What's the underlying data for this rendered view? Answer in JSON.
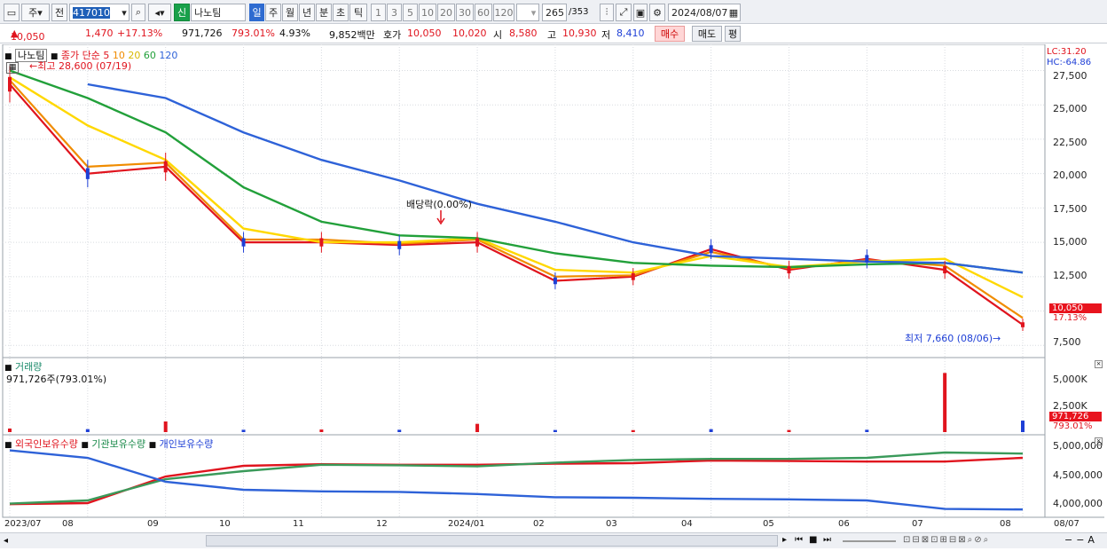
{
  "toolbar": {
    "mode": "주",
    "prev": "전",
    "code": "417010",
    "market": "신",
    "name": "나노팀",
    "periods": [
      "일",
      "주",
      "월",
      "년",
      "분",
      "초",
      "틱"
    ],
    "active_period": "일",
    "nums": [
      "1",
      "3",
      "5",
      "10",
      "20",
      "30",
      "60",
      "120"
    ],
    "count": "265",
    "count_total": "/353",
    "date": "2024/08/07"
  },
  "quote": {
    "price": "10,050",
    "change": "1,470",
    "change_pct": "+17.13%",
    "volume": "971,726",
    "vol_ratio": "793.01%",
    "turnover_rate": "4.93%",
    "amount": "9,852백만",
    "bid_label": "호가",
    "ask": "10,050",
    "bid": "10,020",
    "open_label": "시",
    "open": "8,580",
    "high_label": "고",
    "high": "10,930",
    "low_label": "저",
    "low": "8,410",
    "buy": "매수",
    "sell": "매도",
    "eval": "평"
  },
  "price_panel": {
    "legend_name": "나노팀",
    "legend_desc": "종가 단순",
    "ma": [
      "5",
      "10",
      "20",
      "60",
      "120"
    ],
    "high_note": "최고 28,600 (07/19)",
    "low_note": "최저 7,660 (08/06)",
    "div_note": "배당락(0.00%)",
    "lc": "LC:31.20",
    "hc": "HC:-64.86",
    "yticks": [
      "27,500",
      "25,000",
      "22,500",
      "20,000",
      "17,500",
      "15,000",
      "12,500",
      "7,500"
    ],
    "last_price": "10,050",
    "last_pct": "17.13%"
  },
  "volume_panel": {
    "title": "거래량",
    "value": "971,726주(793.01%)",
    "yticks": [
      "5,000K",
      "2,500K"
    ],
    "last": "971,726",
    "last_pct": "793.01%"
  },
  "holding_panel": {
    "series": [
      "외국인보유수량",
      "기관보유수량",
      "개인보유수량"
    ],
    "yticks": [
      "5,000,000",
      "4,500,000",
      "4,000,000"
    ]
  },
  "xaxis": [
    "2023/07",
    "08",
    "09",
    "10",
    "11",
    "12",
    "2024/01",
    "02",
    "03",
    "04",
    "05",
    "06",
    "07",
    "08"
  ],
  "xaxis_right": "08/07",
  "colors": {
    "ma5": "#e0141e",
    "ma10": "#f08c00",
    "ma20": "#ffd800",
    "ma60": "#22a03a",
    "ma120": "#2e62d8",
    "up": "#e0141e",
    "down": "#1e3fd6"
  },
  "chart_data": [
    {
      "type": "line",
      "title": "나노팀 종가 단순",
      "x": [
        "2023/07",
        "08",
        "09",
        "10",
        "11",
        "12",
        "2024/01",
        "02",
        "03",
        "04",
        "05",
        "06",
        "07",
        "08"
      ],
      "series": [
        {
          "name": "5",
          "values": [
            26500,
            20000,
            20500,
            15000,
            15000,
            14800,
            15000,
            12200,
            12500,
            14500,
            13000,
            13800,
            13000,
            9000
          ]
        },
        {
          "name": "10",
          "values": [
            26800,
            20500,
            20800,
            15200,
            15200,
            14900,
            15200,
            12500,
            12600,
            14300,
            13100,
            13700,
            13300,
            9500
          ]
        },
        {
          "name": "20",
          "values": [
            27000,
            23500,
            21000,
            16000,
            15000,
            15000,
            15300,
            13000,
            12800,
            14000,
            13200,
            13600,
            13800,
            11000
          ]
        },
        {
          "name": "60",
          "values": [
            27500,
            25500,
            23000,
            19000,
            16500,
            15500,
            15300,
            14200,
            13500,
            13300,
            13200,
            13400,
            13500,
            12800
          ]
        },
        {
          "name": "120",
          "values": [
            null,
            26500,
            25500,
            23000,
            21000,
            19500,
            17800,
            16500,
            15000,
            14000,
            13800,
            13600,
            13500,
            12800
          ]
        }
      ],
      "ylim": [
        7000,
        28500
      ]
    },
    {
      "type": "bar",
      "title": "거래량",
      "categories": [
        "2023/07",
        "08",
        "09",
        "10",
        "11",
        "12",
        "2024/01",
        "02",
        "03",
        "04",
        "05",
        "06",
        "07",
        "08"
      ],
      "values": [
        300,
        250,
        900,
        200,
        220,
        200,
        700,
        180,
        170,
        250,
        180,
        200,
        5000,
        971.726
      ],
      "ylim": [
        0,
        6000
      ]
    },
    {
      "type": "line",
      "x": [
        "2023/07",
        "08",
        "09",
        "10",
        "11",
        "12",
        "2024/01",
        "02",
        "03",
        "04",
        "05",
        "06",
        "07",
        "08"
      ],
      "series": [
        {
          "name": "외국인보유수량",
          "values": [
            3980000,
            4000000,
            4500000,
            4700000,
            4730000,
            4720000,
            4720000,
            4740000,
            4750000,
            4800000,
            4790000,
            4780000,
            4780000,
            4850000
          ]
        },
        {
          "name": "기관보유수량",
          "values": [
            3990000,
            4050000,
            4450000,
            4600000,
            4720000,
            4710000,
            4690000,
            4760000,
            4810000,
            4830000,
            4830000,
            4850000,
            4950000,
            4930000
          ]
        },
        {
          "name": "개인보유수량",
          "values": [
            4990000,
            4850000,
            4400000,
            4250000,
            4220000,
            4210000,
            4170000,
            4110000,
            4100000,
            4080000,
            4070000,
            4050000,
            3890000,
            3880000
          ]
        }
      ],
      "ylim": [
        3800000,
        5100000
      ]
    }
  ]
}
